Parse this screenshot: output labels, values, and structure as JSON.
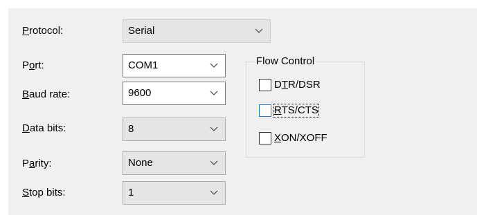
{
  "protocol": {
    "label_pre": "",
    "label_ul": "P",
    "label_post": "rotocol:",
    "value": "Serial"
  },
  "port": {
    "label_pre": "P",
    "label_ul": "o",
    "label_post": "rt:",
    "value": "COM1"
  },
  "baud": {
    "label_pre": "",
    "label_ul": "B",
    "label_post": "aud rate:",
    "value": "9600"
  },
  "databits": {
    "label_pre": "",
    "label_ul": "D",
    "label_post": "ata bits:",
    "value": "8"
  },
  "parity": {
    "label_pre": "P",
    "label_ul": "a",
    "label_post": "rity:",
    "value": "None"
  },
  "stopbits": {
    "label_pre": "",
    "label_ul": "S",
    "label_post": "top bits:",
    "value": "1"
  },
  "flow": {
    "legend": "Flow Control",
    "dtr": {
      "pre": "D",
      "ul": "T",
      "post": "R/DSR",
      "checked": false
    },
    "rts": {
      "pre": "",
      "ul": "R",
      "post": "TS/CTS",
      "checked": false
    },
    "xon": {
      "pre": "",
      "ul": "X",
      "post": "ON/XOFF",
      "checked": false
    }
  },
  "colors": {
    "panel": "#f0f0f0",
    "border": "#7a7a7a",
    "focus": "#1a7ad4"
  },
  "icons": {
    "dropdown": "chevron-down-icon"
  }
}
